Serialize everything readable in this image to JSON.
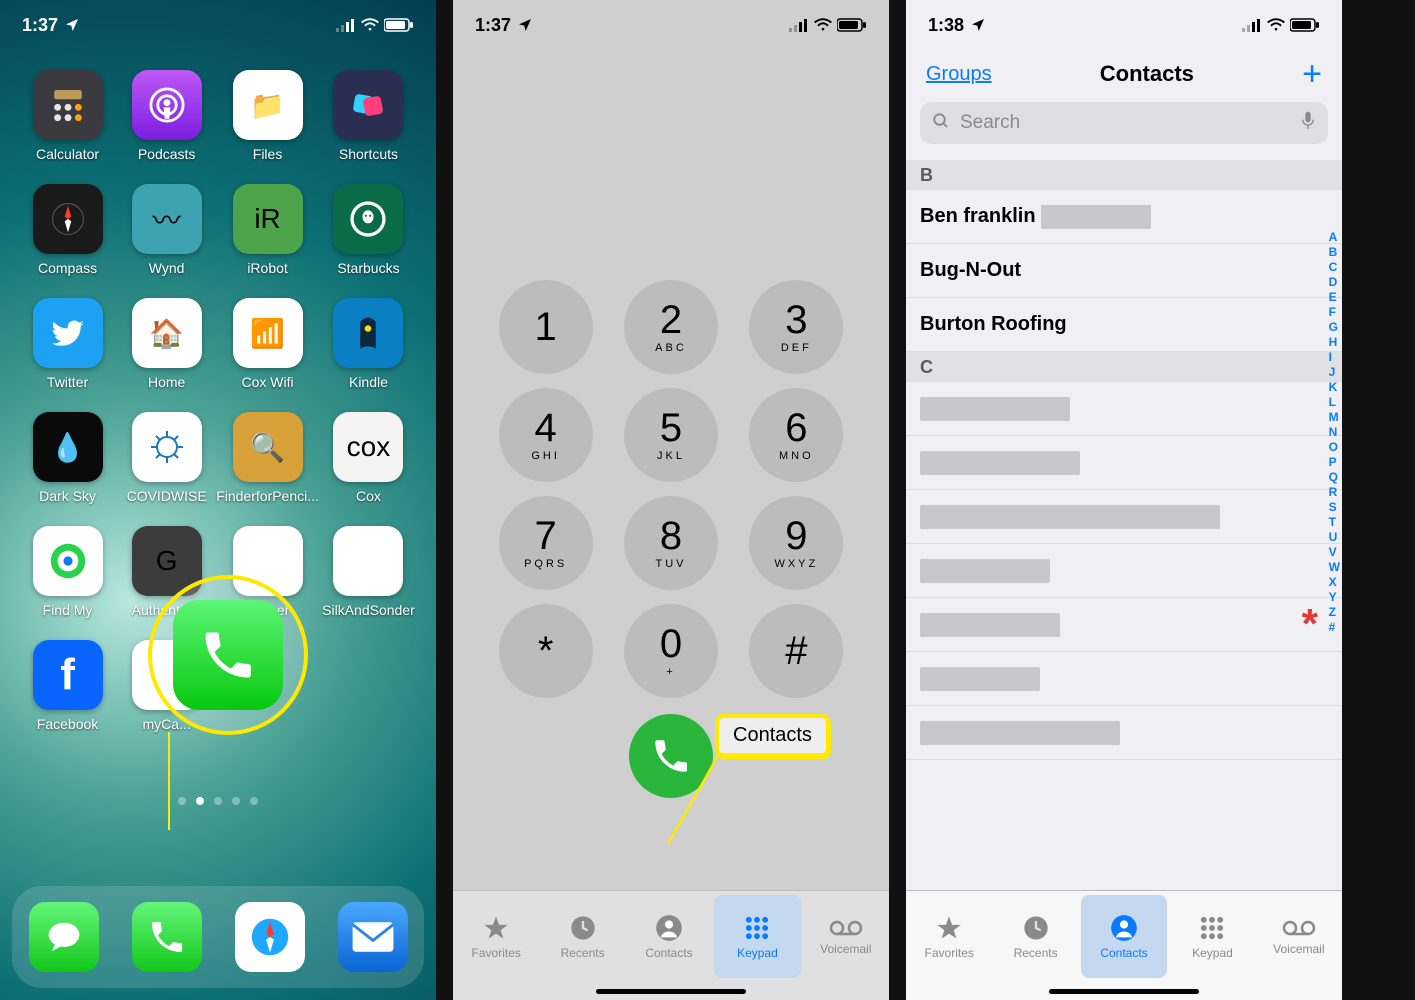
{
  "screen1": {
    "status": {
      "time": "1:37",
      "loc_icon": "location"
    },
    "apps": [
      {
        "name": "Calculator",
        "bg": "#3b3b3f",
        "emoji": ""
      },
      {
        "name": "Podcasts",
        "bg": "linear-gradient(#c058f7,#7a1de0)",
        "emoji": ""
      },
      {
        "name": "Files",
        "bg": "#ffffff",
        "emoji": "📁"
      },
      {
        "name": "Shortcuts",
        "bg": "#2a2f52",
        "emoji": ""
      },
      {
        "name": "Compass",
        "bg": "#1a1a1a",
        "emoji": ""
      },
      {
        "name": "Wynd",
        "bg": "#3ea3b0",
        "emoji": "〰"
      },
      {
        "name": "iRobot",
        "bg": "#4da44a",
        "emoji": "iR"
      },
      {
        "name": "Starbucks",
        "bg": "#0a6b48",
        "emoji": ""
      },
      {
        "name": "Twitter",
        "bg": "#1da1f2",
        "emoji": ""
      },
      {
        "name": "Home",
        "bg": "#ffffff",
        "emoji": "🏠"
      },
      {
        "name": "Cox Wifi",
        "bg": "#ffffff",
        "emoji": "📶"
      },
      {
        "name": "Kindle",
        "bg": "#0a7fc3",
        "emoji": ""
      },
      {
        "name": "Dark Sky",
        "bg": "#0a0a0a",
        "emoji": "💧"
      },
      {
        "name": "COVIDWISE",
        "bg": "#ffffff",
        "emoji": ""
      },
      {
        "name": "FinderforPenci...",
        "bg": "#d8a038",
        "emoji": "🔍"
      },
      {
        "name": "Cox",
        "bg": "#f4f4f4",
        "emoji": "cox"
      },
      {
        "name": "Find My",
        "bg": "#ffffff",
        "emoji": ""
      },
      {
        "name": "Authentic...",
        "bg": "#3c3c3d",
        "emoji": "G"
      },
      {
        "name": "...ather",
        "bg": "#ffffff",
        "emoji": ""
      },
      {
        "name": "SilkAndSonder",
        "bg": "#ffffff",
        "emoji": ""
      },
      {
        "name": "Facebook",
        "bg": "#0866ff",
        "emoji": "f"
      },
      {
        "name": "myCa...",
        "bg": "#ffffff",
        "emoji": ""
      }
    ],
    "dock": [
      {
        "name": "Messages",
        "bg": "linear-gradient(#64f57a,#12c71a)"
      },
      {
        "name": "Phone",
        "bg": "linear-gradient(#64f57a,#12c71a)"
      },
      {
        "name": "Safari",
        "bg": "#ffffff"
      },
      {
        "name": "Mail",
        "bg": "linear-gradient(#4aa8ff,#0a66d4)"
      }
    ],
    "highlight": "Phone app"
  },
  "screen2": {
    "status": {
      "time": "1:37"
    },
    "keys": [
      {
        "n": "1",
        "s": ""
      },
      {
        "n": "2",
        "s": "ABC"
      },
      {
        "n": "3",
        "s": "DEF"
      },
      {
        "n": "4",
        "s": "GHI"
      },
      {
        "n": "5",
        "s": "JKL"
      },
      {
        "n": "6",
        "s": "MNO"
      },
      {
        "n": "7",
        "s": "PQRS"
      },
      {
        "n": "8",
        "s": "TUV"
      },
      {
        "n": "9",
        "s": "WXYZ"
      },
      {
        "n": "*",
        "s": ""
      },
      {
        "n": "0",
        "s": "+"
      },
      {
        "n": "#",
        "s": ""
      }
    ],
    "tabs": [
      "Favorites",
      "Recents",
      "Contacts",
      "Keypad",
      "Voicemail"
    ],
    "selected_tab": "Keypad",
    "callout_label": "Contacts"
  },
  "screen3": {
    "status": {
      "time": "1:38"
    },
    "nav": {
      "groups": "Groups",
      "title": "Contacts",
      "add": "+"
    },
    "search_placeholder": "Search",
    "sections": [
      {
        "letter": "B",
        "rows": [
          {
            "text": "Ben franklin",
            "smudge": 110
          },
          {
            "text": "Bug-N-Out"
          },
          {
            "text": "Burton Roofing"
          }
        ]
      },
      {
        "letter": "C",
        "rows": [
          {
            "smudge": 150
          },
          {
            "smudge": 160
          },
          {
            "smudge": 300
          },
          {
            "smudge": 130
          },
          {
            "smudge": 140
          },
          {
            "smudge": 120
          },
          {
            "smudge": 200
          }
        ]
      }
    ],
    "tabs": [
      "Favorites",
      "Recents",
      "Contacts",
      "Keypad",
      "Voicemail"
    ],
    "selected_tab": "Contacts",
    "index_letters": [
      "A",
      "B",
      "C",
      "D",
      "E",
      "F",
      "G",
      "H",
      "I",
      "J",
      "K",
      "L",
      "M",
      "N",
      "O",
      "P",
      "Q",
      "R",
      "S",
      "T",
      "U",
      "V",
      "W",
      "X",
      "Y",
      "Z",
      "#"
    ]
  }
}
